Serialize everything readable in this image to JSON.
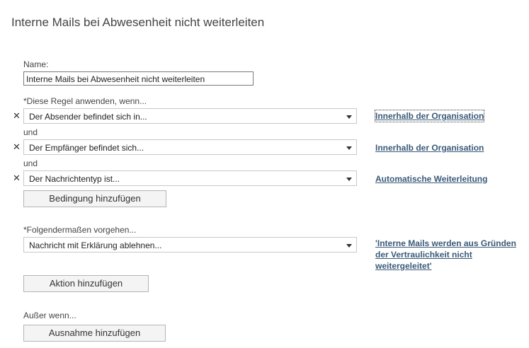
{
  "page_title": "Interne Mails bei Abwesenheit nicht weiterleiten",
  "name_section": {
    "label": "Name:",
    "value": "Interne Mails bei Abwesenheit nicht weiterleiten"
  },
  "conditions_section": {
    "label": "*Diese Regel anwenden, wenn...",
    "rows": [
      {
        "select_value": "Der Absender befindet sich in...",
        "link": "Innerhalb der Organisation"
      },
      {
        "connector": "und",
        "select_value": "Der Empfänger befindet sich...",
        "link": "Innerhalb der Organisation"
      },
      {
        "connector": "und",
        "select_value": "Der Nachrichtentyp ist...",
        "link": "Automatische Weiterleitung"
      }
    ],
    "add_button": "Bedingung hinzufügen"
  },
  "actions_section": {
    "label": "*Folgendermaßen vorgehen...",
    "select_value": "Nachricht mit Erklärung ablehnen...",
    "link": "'Interne Mails werden aus Gründen der Vertraulichkeit nicht weitergeleitet'",
    "add_button": "Aktion hinzufügen"
  },
  "exceptions_section": {
    "label": "Außer wenn...",
    "add_button": "Ausnahme hinzufügen"
  },
  "icons": {
    "remove": "remove-x-icon",
    "dropdown": "chevron-down-icon"
  },
  "colors": {
    "link": "#3a5a78",
    "button_bg": "#f4f4f4",
    "select_border": "#c8c8c8"
  }
}
